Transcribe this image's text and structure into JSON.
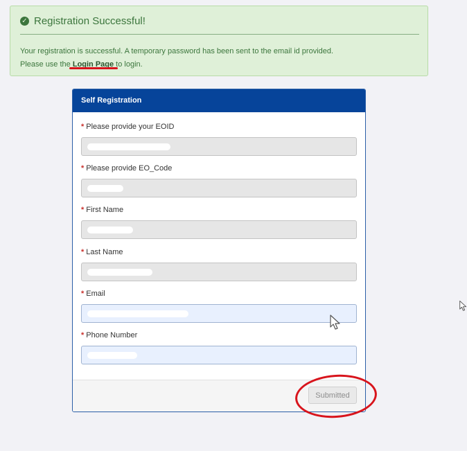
{
  "alert": {
    "title": "Registration Successful!",
    "message_line1": "Your registration is successful. A temporary password has been sent to the email id provided.",
    "message_prefix": "Please use the ",
    "link_text": "Login Page",
    "message_suffix": " to login."
  },
  "form": {
    "heading": "Self Registration",
    "required_marker": "*",
    "fields": [
      {
        "label": "Please provide your EOID"
      },
      {
        "label": "Please provide EO_Code"
      },
      {
        "label": "First Name"
      },
      {
        "label": "Last Name"
      },
      {
        "label": "Email"
      },
      {
        "label": "Phone Number"
      }
    ],
    "submit_label": "Submitted"
  }
}
